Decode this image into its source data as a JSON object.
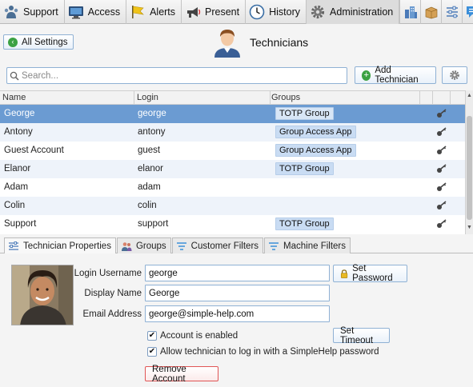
{
  "top_tabs": [
    {
      "label": "Support",
      "icon": "support-icon"
    },
    {
      "label": "Access",
      "icon": "monitor-icon"
    },
    {
      "label": "Alerts",
      "icon": "flag-icon"
    },
    {
      "label": "Present",
      "icon": "megaphone-icon"
    },
    {
      "label": "History",
      "icon": "clock-icon"
    },
    {
      "label": "Administration",
      "icon": "gear-icon",
      "active": true
    }
  ],
  "header": {
    "back_label": "All Settings",
    "title": "Technicians"
  },
  "search": {
    "placeholder": "Search..."
  },
  "add_button_label": "Add Technician",
  "columns": {
    "name": "Name",
    "login": "Login",
    "groups": "Groups"
  },
  "technicians": [
    {
      "name": "George",
      "login": "george",
      "group": "TOTP Group",
      "selected": true
    },
    {
      "name": "Antony",
      "login": "antony",
      "group": "Group Access App"
    },
    {
      "name": "Guest Account",
      "login": "guest",
      "group": "Group Access App"
    },
    {
      "name": "Elanor",
      "login": "elanor",
      "group": "TOTP Group"
    },
    {
      "name": "Adam",
      "login": "adam",
      "group": ""
    },
    {
      "name": "Colin",
      "login": "colin",
      "group": ""
    },
    {
      "name": "Support",
      "login": "support",
      "group": "TOTP Group"
    }
  ],
  "sub_tabs": [
    {
      "label": "Technician Properties",
      "active": true
    },
    {
      "label": "Groups"
    },
    {
      "label": "Customer Filters"
    },
    {
      "label": "Machine Filters"
    }
  ],
  "properties": {
    "username_label": "Login Username",
    "username_value": "george",
    "display_label": "Display Name",
    "display_value": "George",
    "email_label": "Email Address",
    "email_value": "george@simple-help.com",
    "set_password_label": "Set Password",
    "set_timeout_label": "Set Timeout",
    "enabled_label": "Account is enabled",
    "enabled_checked": true,
    "allow_login_label": "Allow technician to log in with a SimpleHelp password",
    "allow_login_checked": true,
    "remove_label": "Remove Account"
  },
  "colors": {
    "accent": "#6b9bd2",
    "group_badge": "#c9dcf3",
    "danger": "#e05555"
  }
}
